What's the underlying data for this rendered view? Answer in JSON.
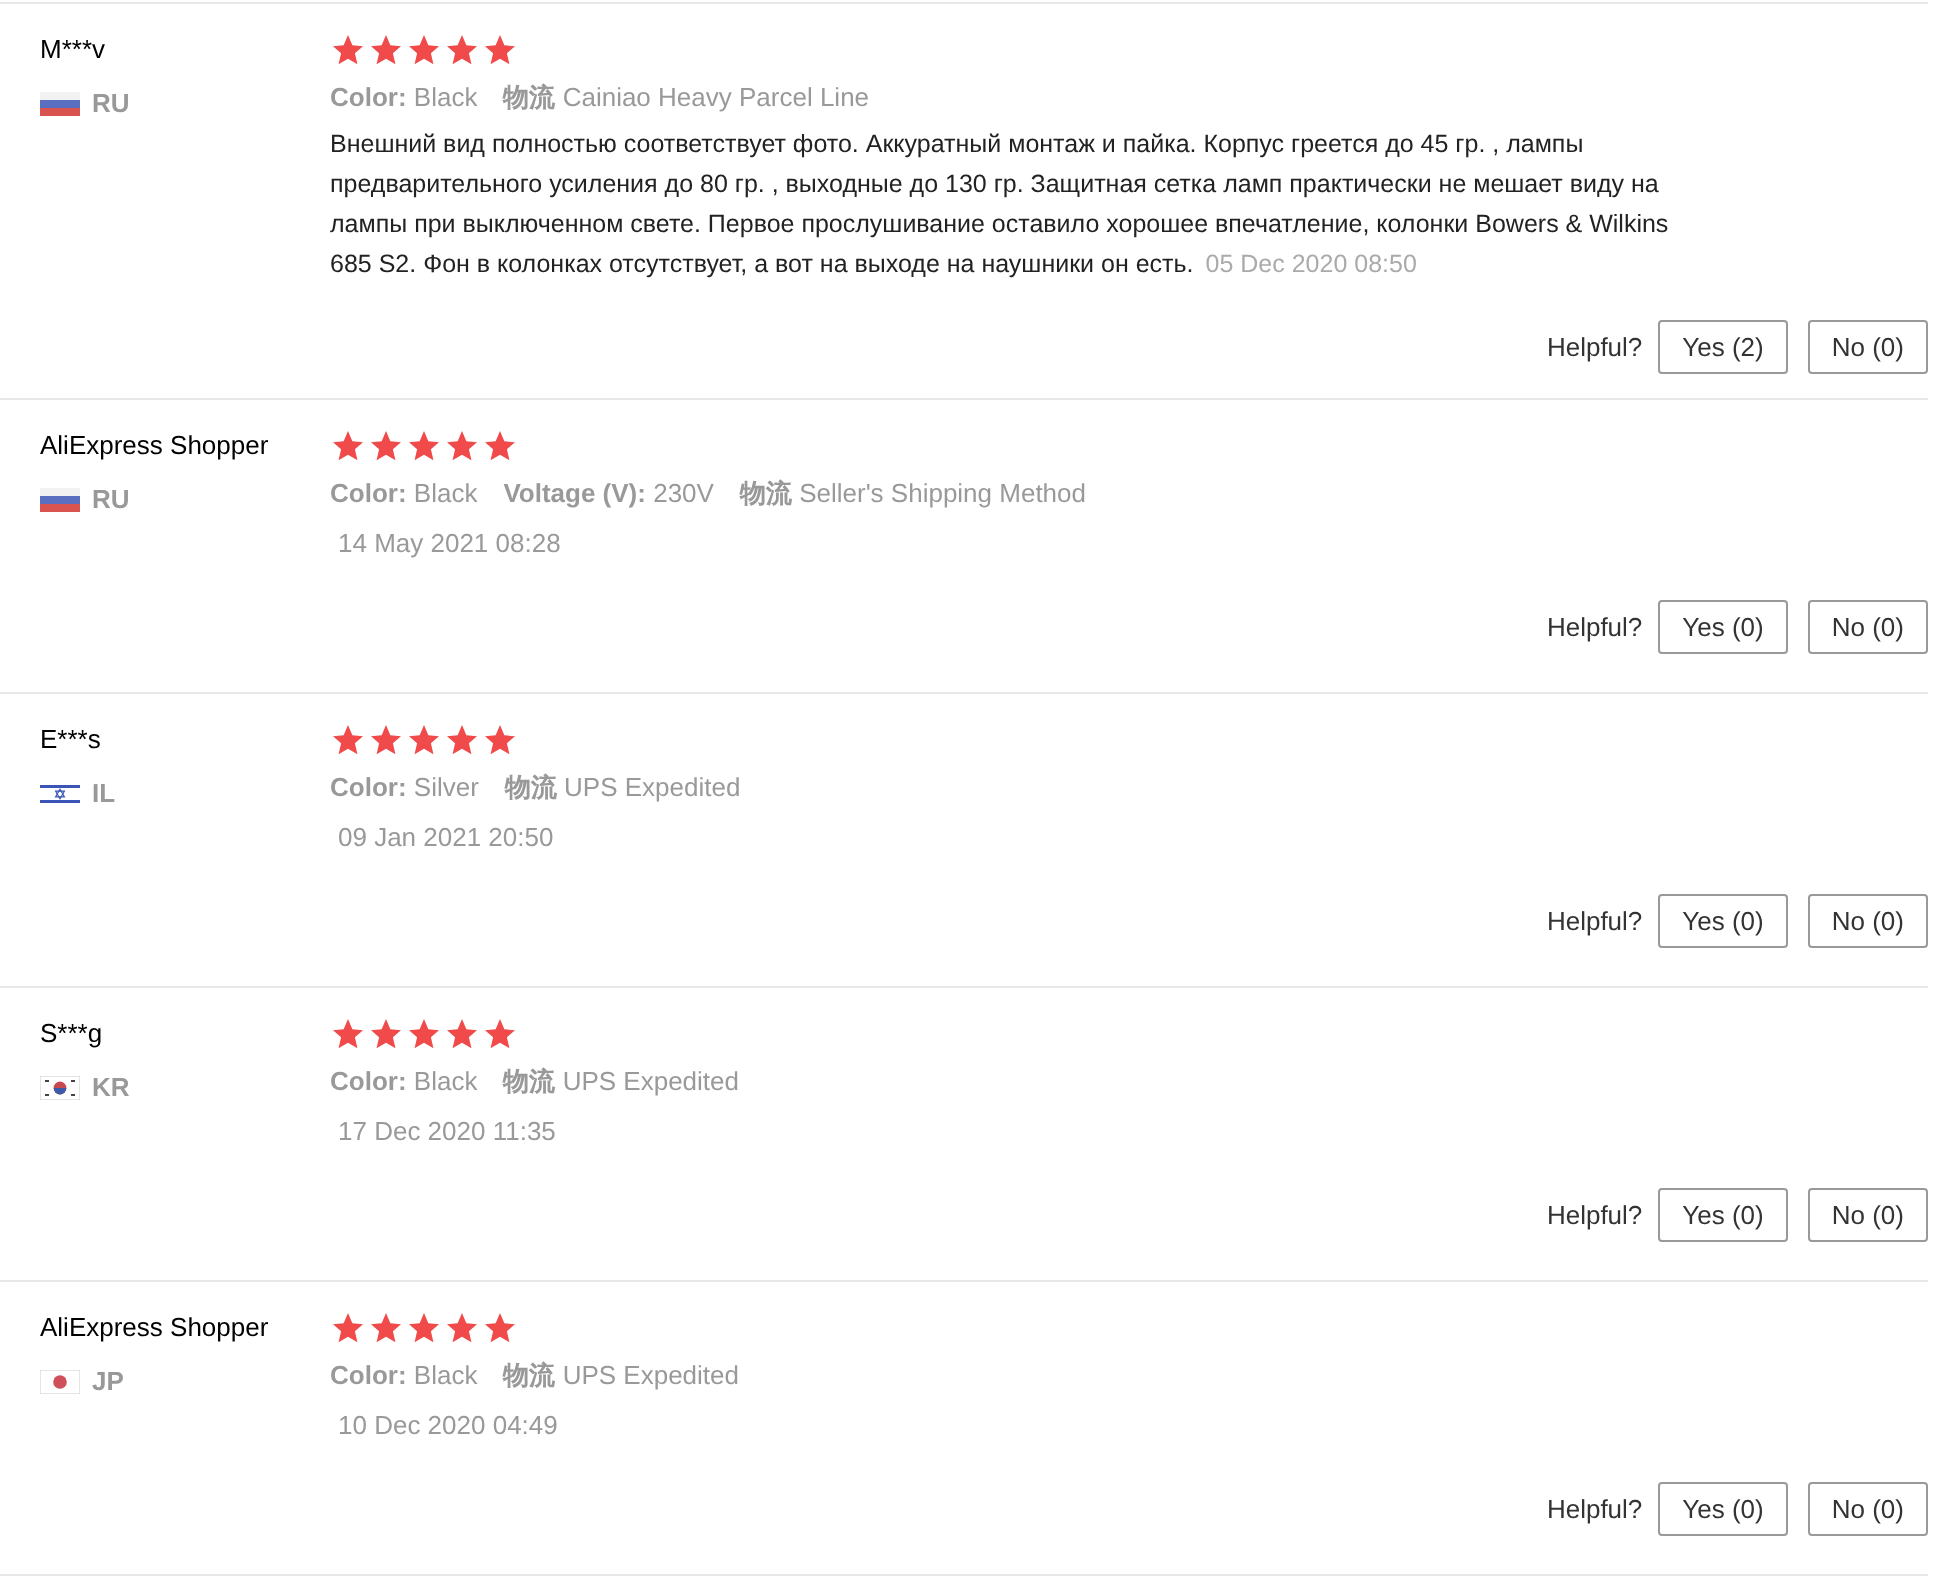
{
  "reviews": [
    {
      "name": "M***v",
      "flag": {
        "kind": "ru"
      },
      "country": "RU",
      "stars": 5,
      "attributes": [
        {
          "label": "Color:",
          "value": "Black"
        },
        {
          "label": "物流",
          "value": "Cainiao Heavy Parcel Line"
        }
      ],
      "text": "Внешний вид полностью соответствует фото. Аккуратный монтаж и пайка. Корпус греется до 45 гр. , лампы предварительного усиления до 80 гр. , выходные до 130 гр. Защитная сетка ламп практически не мешает виду на лампы при выключенном свете. Первое прослушивание оставило хорошее впечатление, колонки Bowers & Wilkins 685 S2. Фон в колонках отсутствует, а вот на выходе на наушники он есть.",
      "date": "05 Dec 2020 08:50",
      "helpful": "Helpful?",
      "yes": "Yes (2)",
      "no": "No (0)"
    },
    {
      "name": "AliExpress Shopper",
      "flag": {
        "kind": "ru"
      },
      "country": "RU",
      "stars": 5,
      "attributes": [
        {
          "label": "Color:",
          "value": "Black"
        },
        {
          "label": "Voltage (V):",
          "value": "230V"
        },
        {
          "label": "物流",
          "value": "Seller's Shipping Method"
        }
      ],
      "date": "14 May 2021 08:28",
      "helpful": "Helpful?",
      "yes": "Yes (0)",
      "no": "No (0)"
    },
    {
      "name": "E***s",
      "flag": {
        "kind": "il"
      },
      "country": "IL",
      "stars": 5,
      "attributes": [
        {
          "label": "Color:",
          "value": "Silver"
        },
        {
          "label": "物流",
          "value": "UPS Expedited"
        }
      ],
      "date": "09 Jan 2021 20:50",
      "helpful": "Helpful?",
      "yes": "Yes (0)",
      "no": "No (0)"
    },
    {
      "name": "S***g",
      "flag": {
        "kind": "kr"
      },
      "country": "KR",
      "stars": 5,
      "attributes": [
        {
          "label": "Color:",
          "value": "Black"
        },
        {
          "label": "物流",
          "value": "UPS Expedited"
        }
      ],
      "date": "17 Dec 2020 11:35",
      "helpful": "Helpful?",
      "yes": "Yes (0)",
      "no": "No (0)"
    },
    {
      "name": "AliExpress Shopper",
      "flag": {
        "kind": "jp"
      },
      "country": "JP",
      "stars": 5,
      "attributes": [
        {
          "label": "Color:",
          "value": "Black"
        },
        {
          "label": "物流",
          "value": "UPS Expedited"
        }
      ],
      "date": "10 Dec 2020 04:49",
      "helpful": "Helpful?",
      "yes": "Yes (0)",
      "no": "No (0)"
    }
  ]
}
